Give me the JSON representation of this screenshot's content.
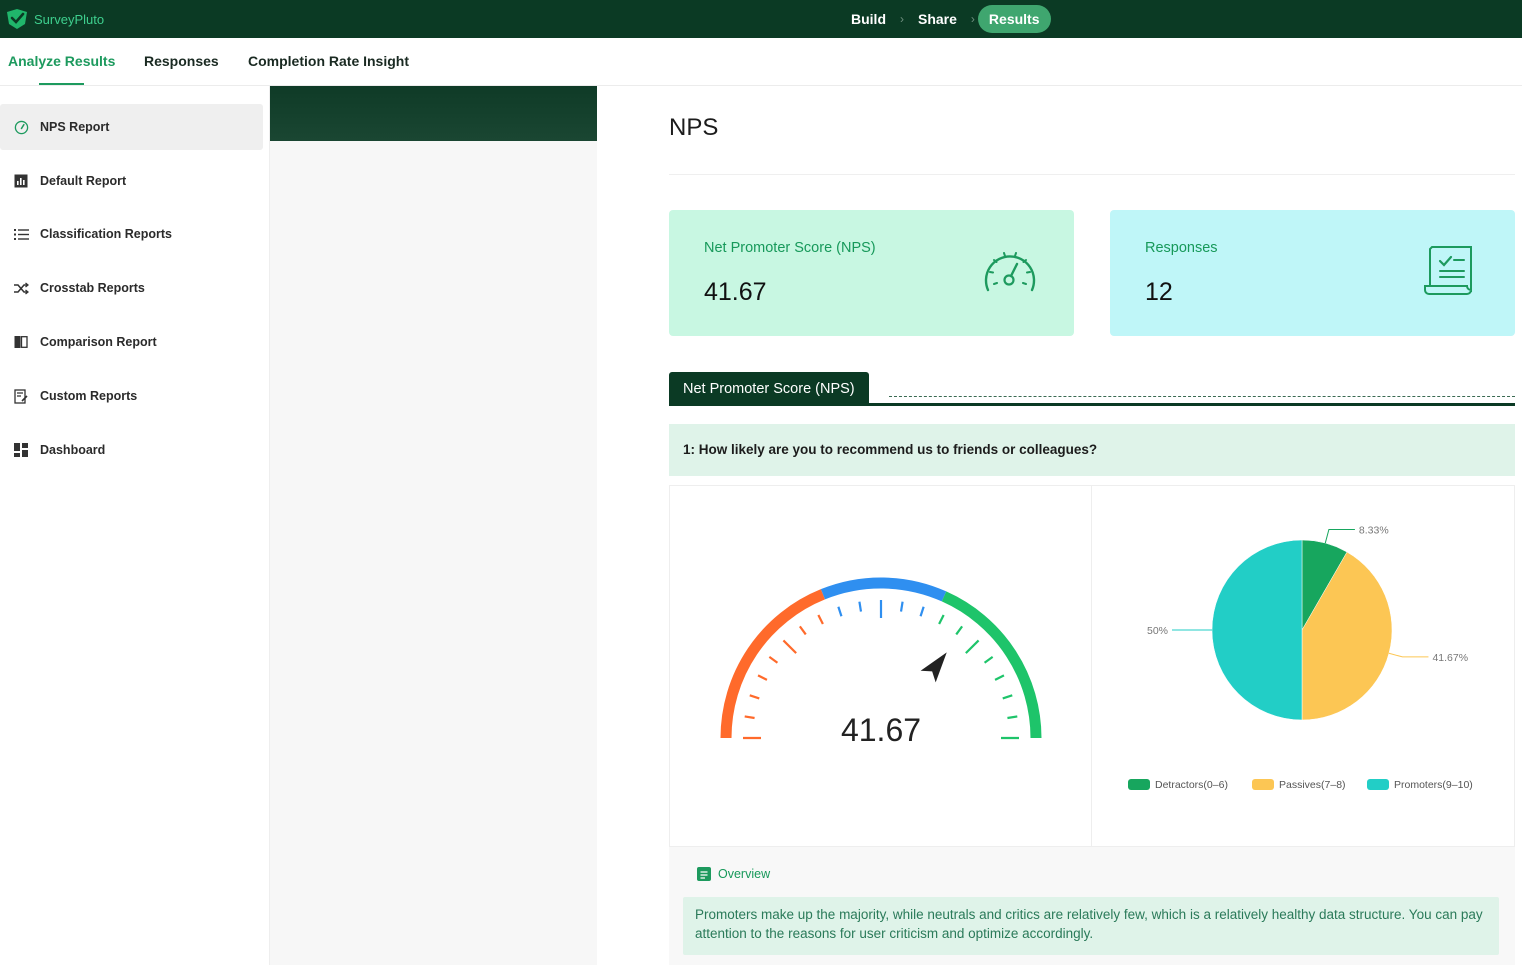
{
  "app": {
    "name": "SurveyPluto"
  },
  "steps": [
    {
      "label": "Build"
    },
    {
      "label": "Share"
    },
    {
      "label": "Results"
    }
  ],
  "subnav": {
    "tabs": [
      {
        "label": "Analyze Results"
      },
      {
        "label": "Responses"
      },
      {
        "label": "Completion Rate Insight"
      }
    ]
  },
  "sidebar": {
    "items": [
      {
        "label": "NPS Report",
        "icon": "gauge-icon"
      },
      {
        "label": "Default Report",
        "icon": "bar-chart-icon"
      },
      {
        "label": "Classification Reports",
        "icon": "list-icon"
      },
      {
        "label": "Crosstab Reports",
        "icon": "shuffle-icon"
      },
      {
        "label": "Comparison Report",
        "icon": "compare-icon"
      },
      {
        "label": "Custom Reports",
        "icon": "edit-report-icon"
      },
      {
        "label": "Dashboard",
        "icon": "dashboard-icon"
      }
    ]
  },
  "main": {
    "title": "NPS",
    "cards": {
      "nps": {
        "label": "Net Promoter Score (NPS)",
        "value": "41.67",
        "icon": "speedometer-icon",
        "bg": "#c8f7e2"
      },
      "responses": {
        "label": "Responses",
        "value": "12",
        "icon": "document-check-icon",
        "bg": "#bff6f8"
      }
    },
    "section_tab": "Net Promoter Score (NPS)",
    "question": "1: How likely are you to recommend us to friends or colleagues?",
    "gauge": {
      "value": 41.67,
      "display": "41.67",
      "min": -100,
      "max": 100,
      "colors": {
        "low": "#ff6a2b",
        "mid": "#2f8ff0",
        "high": "#1ec46a"
      }
    },
    "overview": {
      "title": "Overview",
      "text": "Promoters make up the majority, while neutrals and critics are relatively few, which is a relatively healthy data structure. You can pay attention to the reasons for user criticism and optimize accordingly."
    }
  },
  "chart_data": {
    "type": "pie",
    "categories": [
      "Detractors(0–6)",
      "Passives(7–8)",
      "Promoters(9–10)"
    ],
    "values": [
      8.33,
      41.67,
      50
    ],
    "labels": [
      "8.33%",
      "41.67%",
      "50%"
    ],
    "colors": [
      "#17a65e",
      "#fcc654",
      "#22cec6"
    ],
    "legend": "bottom"
  }
}
